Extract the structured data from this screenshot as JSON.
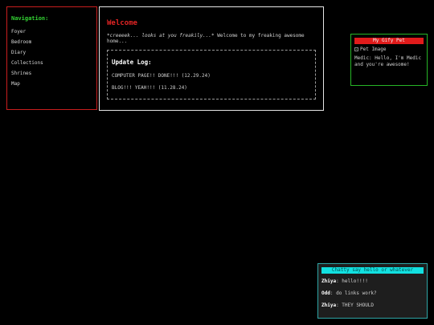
{
  "nav": {
    "title": "Navigation:",
    "items": [
      {
        "label": "Foyer"
      },
      {
        "label": "Bedroom"
      },
      {
        "label": "Diary"
      },
      {
        "label": "Collections"
      },
      {
        "label": "Shrines"
      },
      {
        "label": "Map"
      }
    ]
  },
  "main": {
    "title": "Welcome",
    "intro_italic": "*creeeek... looks at you freakily...*",
    "intro_rest": " Welcome to my freaking awesome home...",
    "update_log": {
      "title": "Update Log:",
      "entries": [
        {
          "text": "COMPUTER PAGE!! DONE!!! (12.29.24)"
        },
        {
          "text": "BLOG!!! YEAH!!! (11.28.24)"
        }
      ]
    }
  },
  "pet": {
    "title": "My Gify Pet",
    "image_alt": "Pet Image",
    "text": "Medic: Hello, I'm Medic and you're awesome!"
  },
  "chat": {
    "header": "Chatty say hello or whatever",
    "messages": [
      {
        "user": "Zhiya",
        "text": "hello!!!!"
      },
      {
        "user": "Odd",
        "text": "do links work?"
      },
      {
        "user": "Zhiya",
        "text": "THEY SHOULD"
      }
    ]
  },
  "colors": {
    "nav_border": "#c81e1e",
    "nav_title": "#33d433",
    "welcome_title": "#e02424",
    "pet_border": "#26b526",
    "pet_header": "#e01b1b",
    "chat_border": "#2fa6a6",
    "chat_header": "#12e0e0"
  }
}
